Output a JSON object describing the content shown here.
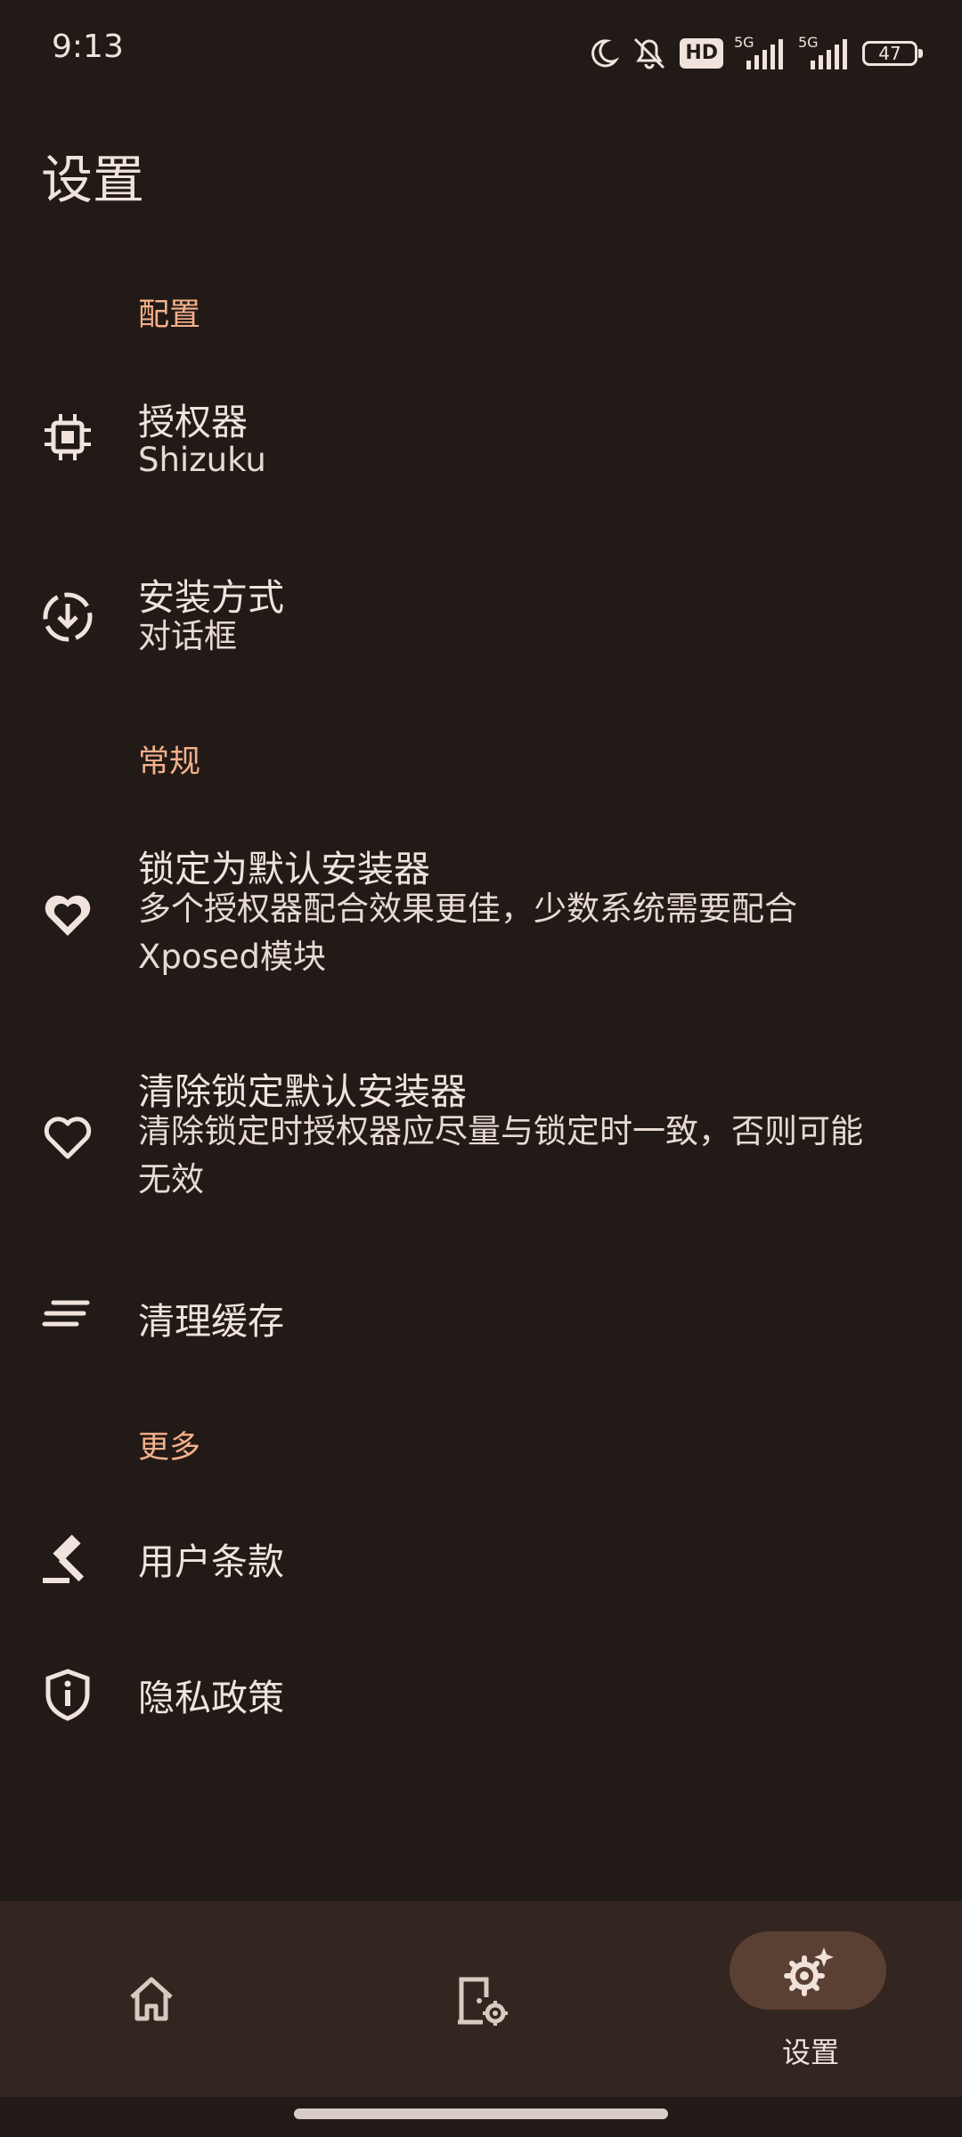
{
  "status_bar": {
    "time": "9:13",
    "network_1": "5G",
    "network_2": "5G",
    "hd": "HD",
    "battery": "47"
  },
  "page": {
    "title": "设置"
  },
  "sections": {
    "config": "配置",
    "general": "常规",
    "more": "更多"
  },
  "items": {
    "authorizer": {
      "title": "授权器",
      "subtitle": "Shizuku",
      "icon": "chip-icon"
    },
    "install_method": {
      "title": "安装方式",
      "subtitle": "对话框",
      "icon": "download-circle-icon"
    },
    "lock_default": {
      "title": "锁定为默认安装器",
      "subtitle": "多个授权器配合效果更佳，少数系统需要配合Xposed模块",
      "icon": "heart-filled-icon"
    },
    "clear_lock": {
      "title": "清除锁定默认安装器",
      "subtitle": "清除锁定时授权器应尽量与锁定时一致，否则可能无效",
      "icon": "heart-outline-icon"
    },
    "clear_cache": {
      "title": "清理缓存",
      "icon": "clear-lines-icon"
    },
    "terms": {
      "title": "用户条款",
      "icon": "gavel-icon"
    },
    "privacy": {
      "title": "隐私政策",
      "icon": "shield-info-icon"
    }
  },
  "bottom_nav": {
    "home_icon": "home-icon",
    "apps_icon": "app-settings-icon",
    "settings_icon": "settings-sparkle-icon",
    "settings_label": "设置"
  },
  "colors": {
    "background": "#221a17",
    "accent": "#f4b08a",
    "text": "#efe3dc",
    "nav_bg": "#33251f",
    "pill": "#5a3f33"
  }
}
